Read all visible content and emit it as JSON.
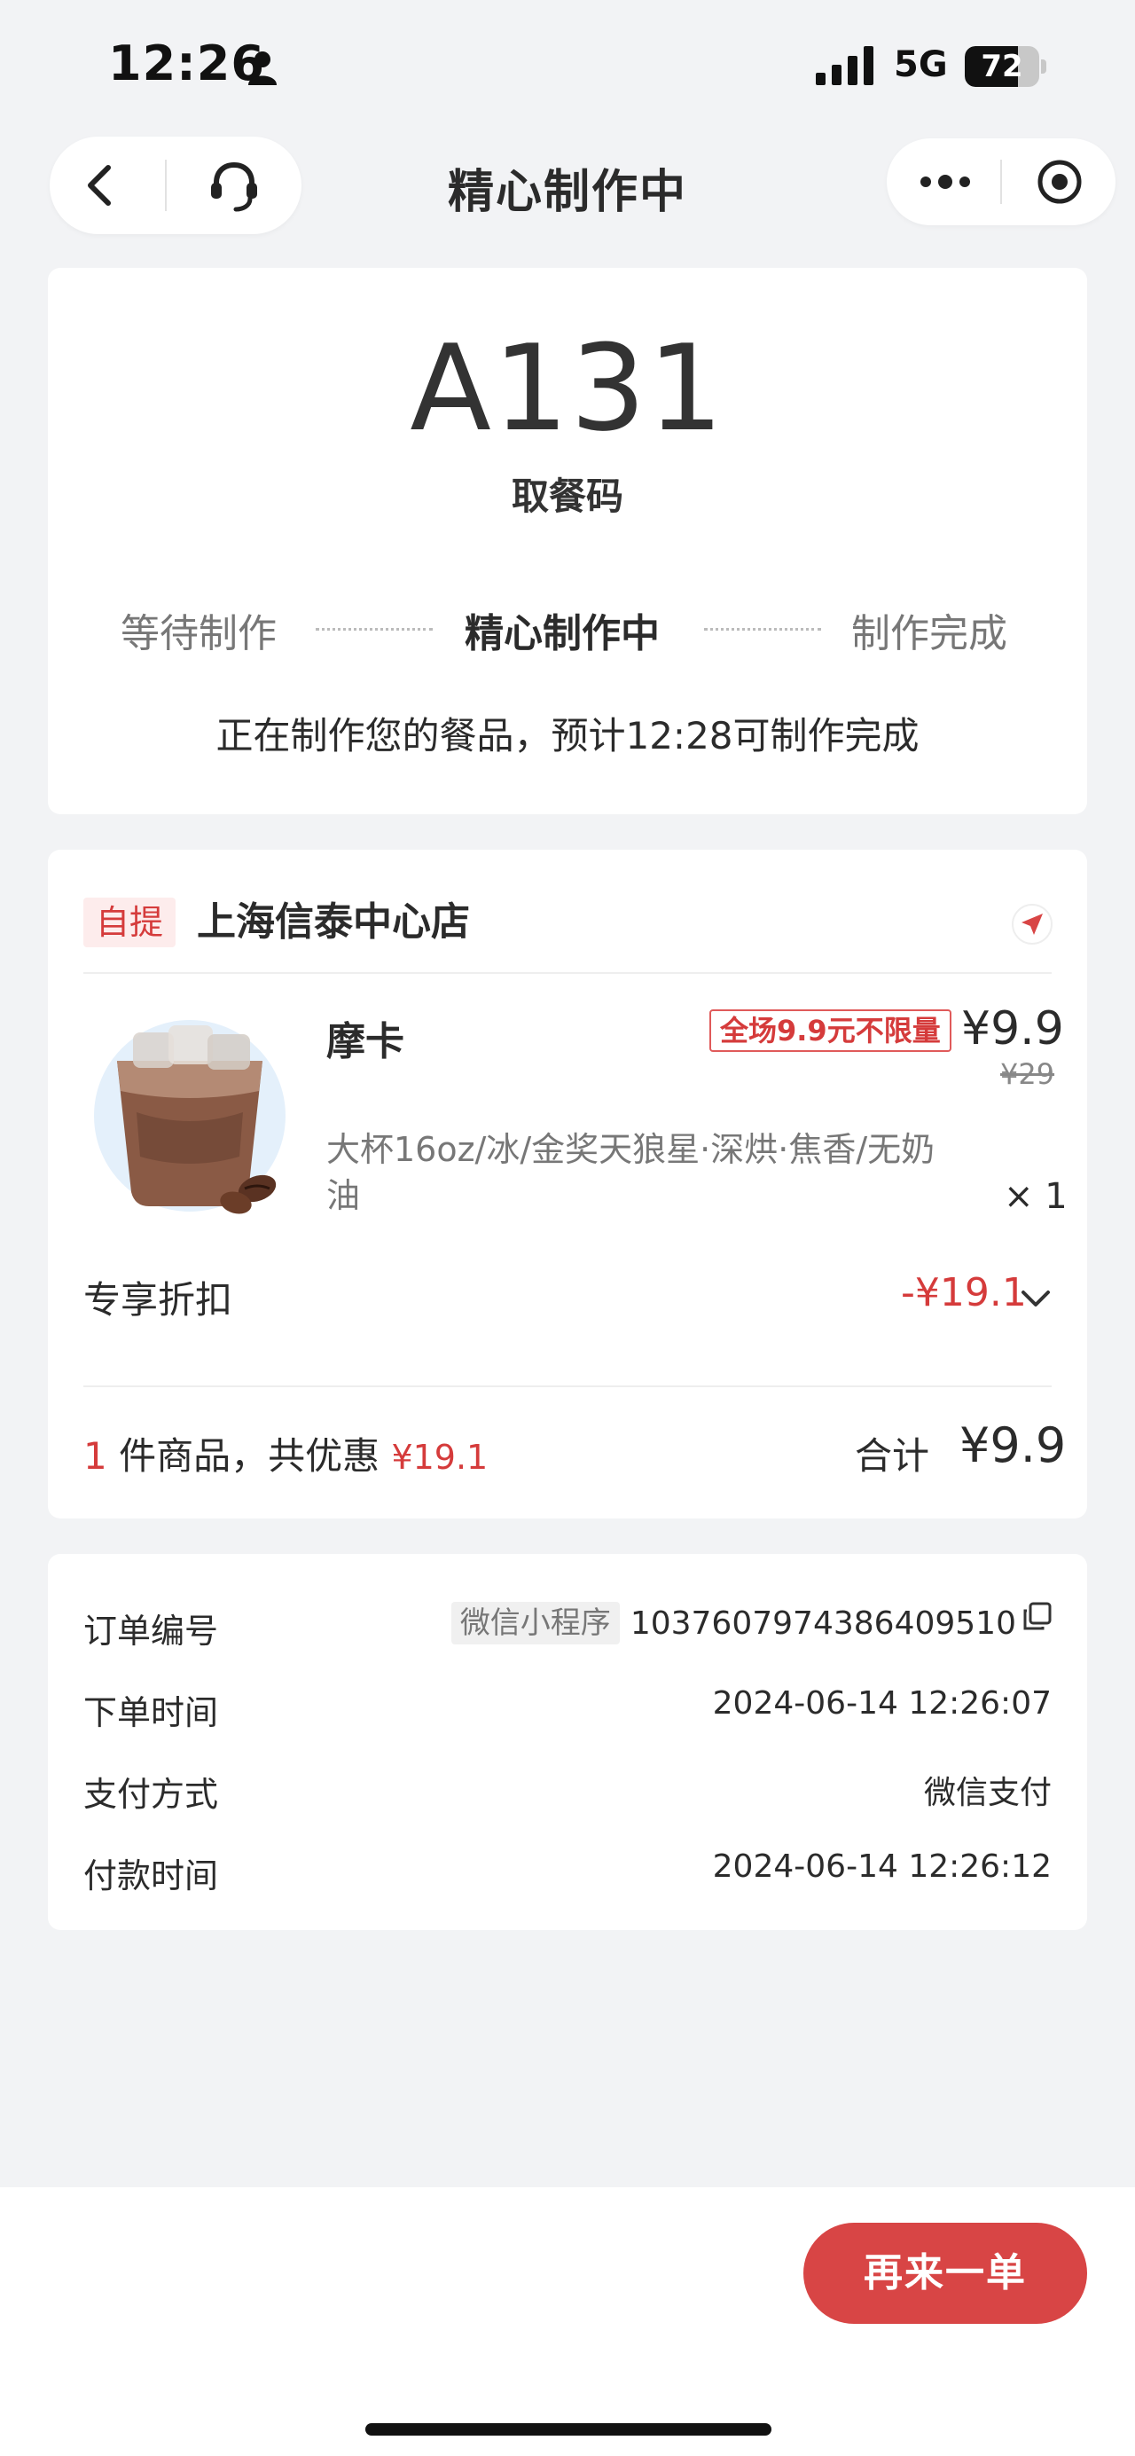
{
  "status_bar": {
    "time": "12:26",
    "network": "5G",
    "battery": "72",
    "battery_level": 0.72
  },
  "nav": {
    "title": "精心制作中"
  },
  "pickup": {
    "code": "A131",
    "code_label": "取餐码",
    "steps": [
      "等待制作",
      "精心制作中",
      "制作完成"
    ],
    "current_step": 1,
    "note": "正在制作您的餐品，预计12:28可制作完成"
  },
  "store": {
    "tag": "自提",
    "name": "上海信泰中心店"
  },
  "product": {
    "name": "摩卡",
    "promo": "全场9.9元不限量",
    "price": "¥9.9",
    "original_price": "¥29",
    "spec": "大杯16oz/冰/金奖天狼星·深烘·焦香/无奶油",
    "quantity": "× 1"
  },
  "discount": {
    "label": "专享折扣",
    "value": "-¥19.1"
  },
  "summary": {
    "count": "1",
    "text": " 件商品，共优惠 ",
    "saved": "¥19.1",
    "total_label": "合计",
    "total": "¥9.9"
  },
  "info": {
    "order_no_label": "订单编号",
    "channel": "微信小程序",
    "order_no": "1037607974386409510",
    "order_time_label": "下单时间",
    "order_time": "2024-06-14 12:26:07",
    "pay_method_label": "支付方式",
    "pay_method": "微信支付",
    "pay_time_label": "付款时间",
    "pay_time": "2024-06-14 12:26:12"
  },
  "actions": {
    "reorder": "再来一单"
  },
  "colors": {
    "accent": "#d84545",
    "background": "#f2f3f5",
    "card": "#ffffff"
  }
}
